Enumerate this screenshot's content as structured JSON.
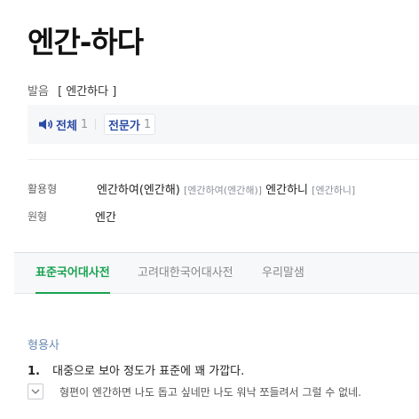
{
  "entry": {
    "headword": "엔간-하다"
  },
  "pronunciation": {
    "label": "발음",
    "text": "[ 엔간하다 ]",
    "buttons": [
      {
        "name": "전체",
        "count": "1"
      },
      {
        "name": "전문가",
        "count": "1"
      }
    ]
  },
  "inflection": {
    "label": "활용형",
    "form1": "엔간하여(엔간해)",
    "form1_pron": "[엔간하여(엔간해)]",
    "form2": "엔간하니",
    "form2_pron": "[엔간하니]"
  },
  "root": {
    "label": "원형",
    "value": "엔간"
  },
  "tabs": [
    {
      "label": "표준국어대사전",
      "active": true
    },
    {
      "label": "고려대한국어대사전",
      "active": false
    },
    {
      "label": "우리말샘",
      "active": false
    }
  ],
  "definition": {
    "pos": "형용사",
    "number": "1.",
    "sense": "대중으로 보아 정도가 표준에 꽤 가깝다.",
    "example": "형편이 엔간하면 나도 돕고 싶네만 나도 워낙 쪼들려서 그럴 수 없네."
  },
  "colors": {
    "accent_green": "#18a350",
    "pron_blue": "#2b4aa5"
  }
}
